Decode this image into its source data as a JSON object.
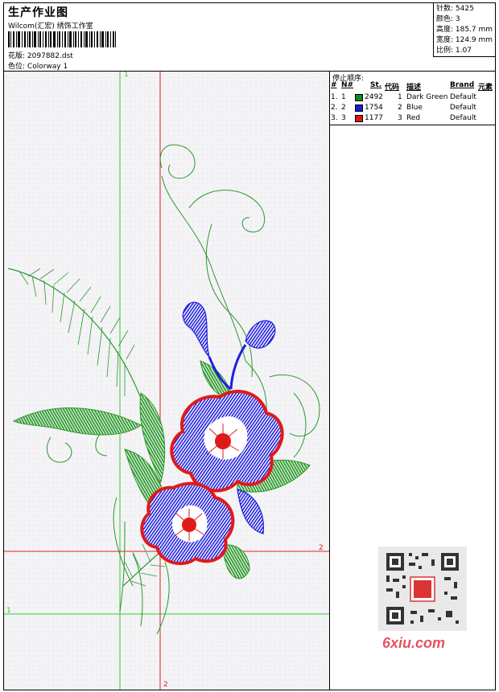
{
  "header": {
    "title": "生产作业图",
    "company": "Wilcom(汇宏) 绣饰工作室",
    "design_label": "花版:",
    "design_value": "2097882.dst",
    "colorway_label": "色位:",
    "colorway_value": "Colorway 1"
  },
  "stats": {
    "stitches": "针数: 5425",
    "colors": "颜色: 3",
    "height": "高度: 185.7 mm",
    "width": "宽度: 124.9 mm",
    "scale": "比例: 1.07"
  },
  "stop_sequence": {
    "title": "停止顺序:",
    "headers": {
      "num": "#",
      "n": "N#",
      "st": "St.",
      "code": "代码",
      "desc": "描述",
      "brand": "Brand",
      "element": "元素"
    },
    "rows": [
      {
        "num": "1.",
        "n": "1",
        "st": "2492",
        "code": "1",
        "desc": "Dark Green",
        "brand": "Default",
        "color": "#0e8a1a"
      },
      {
        "num": "2.",
        "n": "2",
        "st": "1754",
        "code": "2",
        "desc": "Blue",
        "brand": "Default",
        "color": "#1a1adb"
      },
      {
        "num": "3.",
        "n": "3",
        "st": "1177",
        "code": "3",
        "desc": "Red",
        "brand": "Default",
        "color": "#e01414"
      }
    ]
  },
  "guides": {
    "marker_1": "1",
    "marker_2": "2"
  },
  "watermark": {
    "logo_text": "6xiu.com"
  },
  "colors": {
    "guide_green": "#33cc33",
    "guide_red": "#e02020",
    "thread_green": "#2a9a2a",
    "thread_blue": "#1f1fe0",
    "thread_red": "#e01a1a"
  }
}
